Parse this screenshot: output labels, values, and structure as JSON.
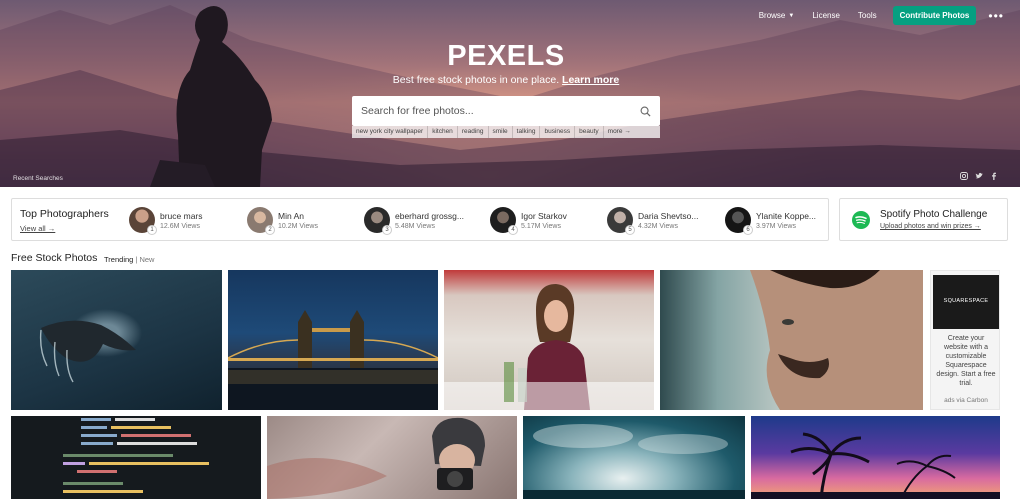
{
  "nav": {
    "browse": "Browse",
    "license": "License",
    "tools": "Tools",
    "contribute": "Contribute Photos",
    "more": "•••"
  },
  "hero": {
    "brand": "PEXELS",
    "tagline": "Best free stock photos in one place.",
    "learn_more": "Learn more",
    "recent_searches": "Recent Searches"
  },
  "search": {
    "placeholder": "Search for free photos...",
    "suggestions": [
      "new york city wallpaper",
      "kitchen",
      "reading",
      "smile",
      "talking",
      "business",
      "beauty",
      "more →"
    ]
  },
  "top_photographers": {
    "title": "Top Photographers",
    "view_all": "View all →",
    "items": [
      {
        "rank": "1",
        "name": "bruce mars",
        "views": "12.6M Views"
      },
      {
        "rank": "2",
        "name": "Min An",
        "views": "10.2M Views"
      },
      {
        "rank": "3",
        "name": "eberhard grossg...",
        "views": "5.48M Views"
      },
      {
        "rank": "4",
        "name": "Igor Starkov",
        "views": "5.17M Views"
      },
      {
        "rank": "5",
        "name": "Daria Shevtso...",
        "views": "4.32M Views"
      },
      {
        "rank": "6",
        "name": "Ylanite Koppe...",
        "views": "3.97M Views"
      }
    ]
  },
  "spotify": {
    "title": "Spotify Photo Challenge",
    "link": "Upload photos and win prizes →"
  },
  "section": {
    "title": "Free Stock Photos",
    "tab_trending": "Trending",
    "separator": "|",
    "tab_new": "New"
  },
  "ad": {
    "brand": "SQUARESPACE",
    "text": "Create your website with a customizable Squarespace design. Start a free trial.",
    "footer": "ads via Carbon"
  },
  "colors": {
    "contribute": "#05a081",
    "spotify": "#1db954"
  }
}
